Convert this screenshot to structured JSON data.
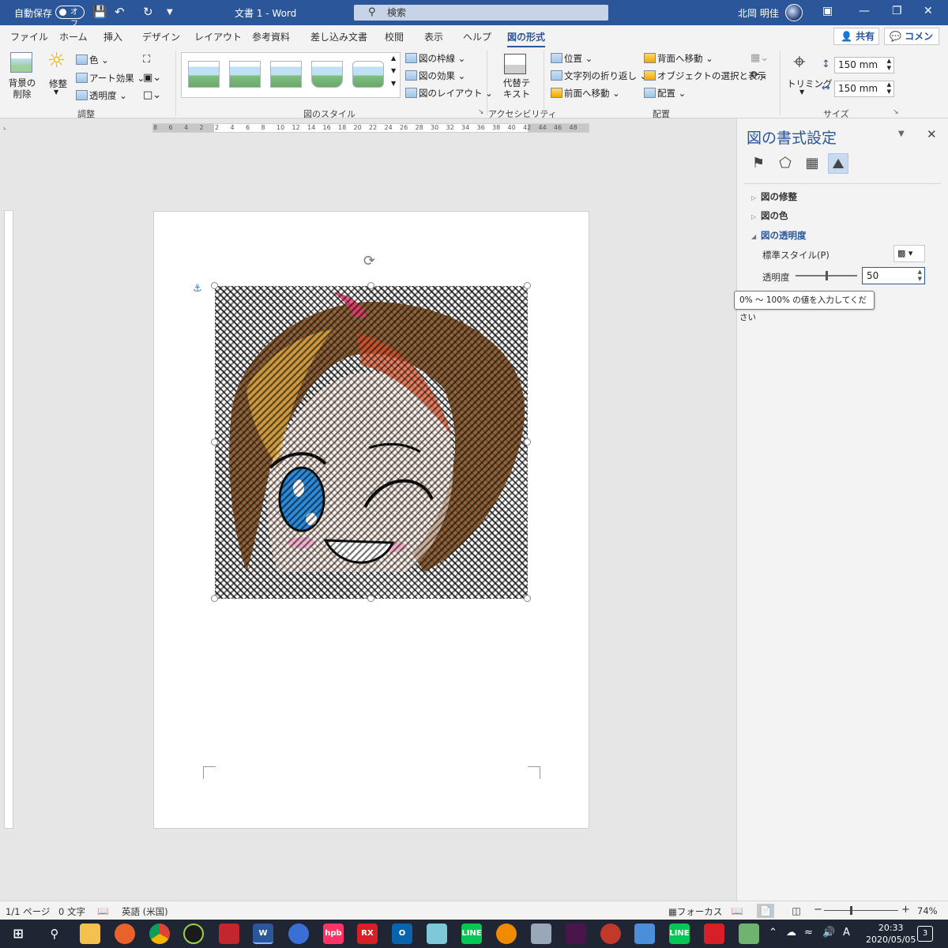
{
  "titlebar": {
    "autosave_label": "自動保存",
    "autosave_state": "オフ",
    "doc_title": "文書 1  -  Word",
    "search_placeholder": "検索",
    "user_name": "北岡 明佳"
  },
  "tabs": [
    "ファイル",
    "ホーム",
    "挿入",
    "デザイン",
    "レイアウト",
    "参考資料",
    "差し込み文書",
    "校閲",
    "表示",
    "ヘルプ",
    "図の形式"
  ],
  "active_tab": "図の形式",
  "share_label": "共有",
  "comment_label": "コメント",
  "ribbon": {
    "remove_bg_label": "背景の削除",
    "corrections_label": "修整",
    "color_label": "色",
    "art_effects_label": "アート効果",
    "transparency_label": "透明度",
    "adjust_group": "調整",
    "styles_group": "図のスタイル",
    "border_label": "図の枠線",
    "effects_label": "図の効果",
    "layout_label": "図のレイアウト",
    "alt_text_label": "代替テキスト",
    "accessibility_group": "アクセシビリティ",
    "position_label": "位置",
    "wrap_text_label": "文字列の折り返し",
    "bring_forward_label": "前面へ移動",
    "send_backward_label": "背面へ移動",
    "selection_pane_label": "オブジェクトの選択と表示",
    "align_label": "配置",
    "arrange_group": "配置",
    "crop_label": "トリミング",
    "height_value": "150 mm",
    "width_value": "150 mm",
    "size_group": "サイズ"
  },
  "hruler_ticks": [
    "8",
    "6",
    "4",
    "2",
    "2",
    "4",
    "6",
    "8",
    "10",
    "12",
    "14",
    "16",
    "18",
    "20",
    "22",
    "24",
    "26",
    "28",
    "30",
    "32",
    "34",
    "36",
    "38",
    "40",
    "42",
    "44",
    "46",
    "48"
  ],
  "pane": {
    "title": "図の書式設定",
    "sections": {
      "corrections": "図の修整",
      "color": "図の色",
      "transparency": "図の透明度"
    },
    "preset_label": "標準スタイル(P)",
    "transparency_label": "透明度",
    "transparency_value": "50",
    "tooltip": "0% 〜 100% の値を入力してください"
  },
  "status": {
    "page": "1/1 ページ",
    "words": "0 文字",
    "language": "英語 (米国)",
    "focus": "フォーカス",
    "zoom": "74%"
  },
  "taskbar": {
    "time": "20:33",
    "date": "2020/05/05",
    "notifications": "3",
    "ime": "A"
  }
}
